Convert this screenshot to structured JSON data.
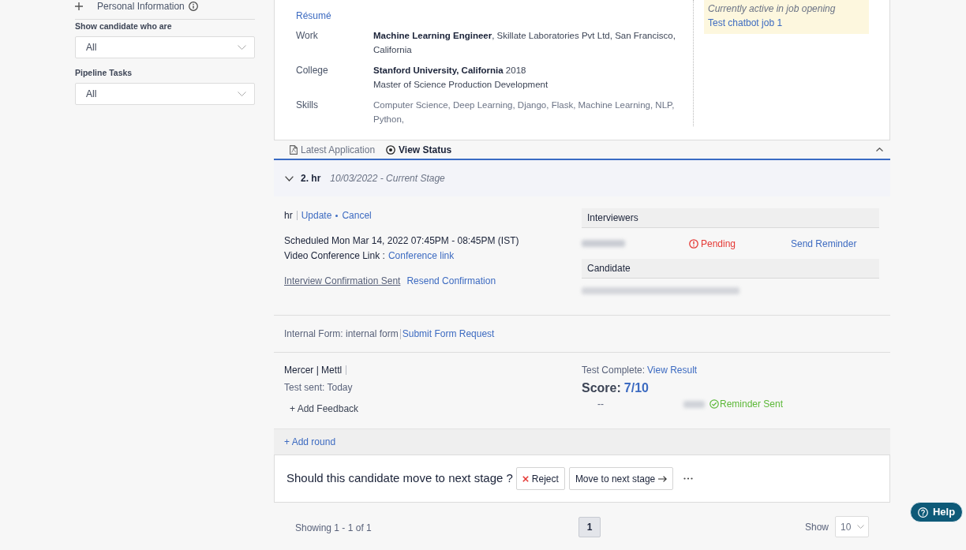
{
  "sidebar": {
    "section": {
      "title": "Personal Information"
    },
    "filters": [
      {
        "label": "Show candidate who are",
        "value": "All"
      },
      {
        "label": "Pipeline Tasks",
        "value": "All"
      }
    ]
  },
  "profile": {
    "resume_link": "Résumé",
    "fields": [
      {
        "label": "Work",
        "kind": "detail",
        "lines": [
          "**Machine Learning Engineer**, Skillate Laboratories Pvt Ltd, San Francisco, California"
        ]
      },
      {
        "label": "College",
        "kind": "detail",
        "lines": [
          "**Stanford University, California** 2018",
          "Master of Science Production Development"
        ]
      },
      {
        "label": "Skills",
        "kind": "list",
        "lines": [
          "Computer Science, Deep Learning, Django, Flask, Machine Learning, NLP, Python,"
        ]
      }
    ],
    "active_opening": {
      "note": "Currently active in job opening",
      "job_link": "Test chatbot job 1"
    }
  },
  "status_tabs": [
    {
      "label": "Latest Application",
      "kind": "document",
      "selected": false
    },
    {
      "label": "View Status",
      "kind": "status",
      "selected": true
    }
  ],
  "stage": {
    "title": "2. hr",
    "date": "10/03/2022 - Current Stage",
    "expanded": true
  },
  "interview": {
    "name": "hr",
    "actions": [
      "Update",
      "Cancel"
    ],
    "schedule": "Scheduled Mon Mar 14, 2022 07:45PM - 08:45PM (IST)",
    "conference_label": "Video Conference Link :",
    "conference_link": "Conference link",
    "confirmation": "Interview Confirmation Sent",
    "resend_link": "Resend Confirmation"
  },
  "participants": [
    {
      "heading": "Interviewers",
      "rows": [
        {
          "kind": "person",
          "status": {
            "kind": "pending",
            "label": "Pending"
          },
          "action": "Send Reminder"
        }
      ]
    },
    {
      "heading": "Candidate",
      "rows": [
        {
          "kind": "email"
        }
      ]
    }
  ],
  "internal_form": {
    "text": "Internal Form: internal form",
    "link": "Submit Form Request"
  },
  "assessment": {
    "vendor": "Mercer | Mettl",
    "sent": "Test sent: Today",
    "add_feedback": "+ Add Feedback",
    "status": "Test Complete:",
    "result_link": "View Result",
    "score_label": "Score:",
    "score": "7/10",
    "dash": "--",
    "reminder": {
      "kind": "sent",
      "label": "Reminder Sent"
    }
  },
  "add_round": "+ Add round",
  "decision": {
    "question": "Should this candidate move to next stage ?",
    "buttons": [
      {
        "label": "Reject",
        "kind": "reject"
      },
      {
        "label": "Move to next stage",
        "kind": "advance"
      }
    ]
  },
  "pagination": {
    "summary": "Showing 1 - 1 of 1",
    "pages": [
      {
        "label": "1",
        "selected": true
      }
    ],
    "show_label": "Show",
    "page_size": "10"
  },
  "help": {
    "label": "Help"
  }
}
